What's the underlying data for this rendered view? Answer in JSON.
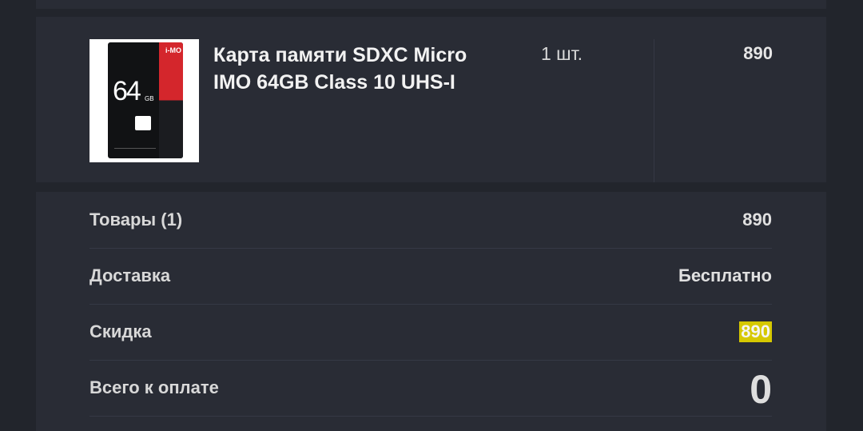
{
  "item": {
    "title": "Карта памяти SDXC Micro IMO 64GB Class 10 UHS-I",
    "quantity": "1 шт.",
    "price": "890",
    "image": {
      "brand": "i-MO",
      "capacity": "64",
      "capacity_unit": "GB"
    }
  },
  "summary": {
    "rows": [
      {
        "label": "Товары (1)",
        "value": "890"
      },
      {
        "label": "Доставка",
        "value": "Бесплатно"
      },
      {
        "label": "Скидка",
        "value": "890"
      },
      {
        "label": "Всего к оплате",
        "value": "0"
      }
    ]
  },
  "colors": {
    "background": "#22252c",
    "card": "#292c35",
    "discount_highlight": "#d6c800"
  }
}
